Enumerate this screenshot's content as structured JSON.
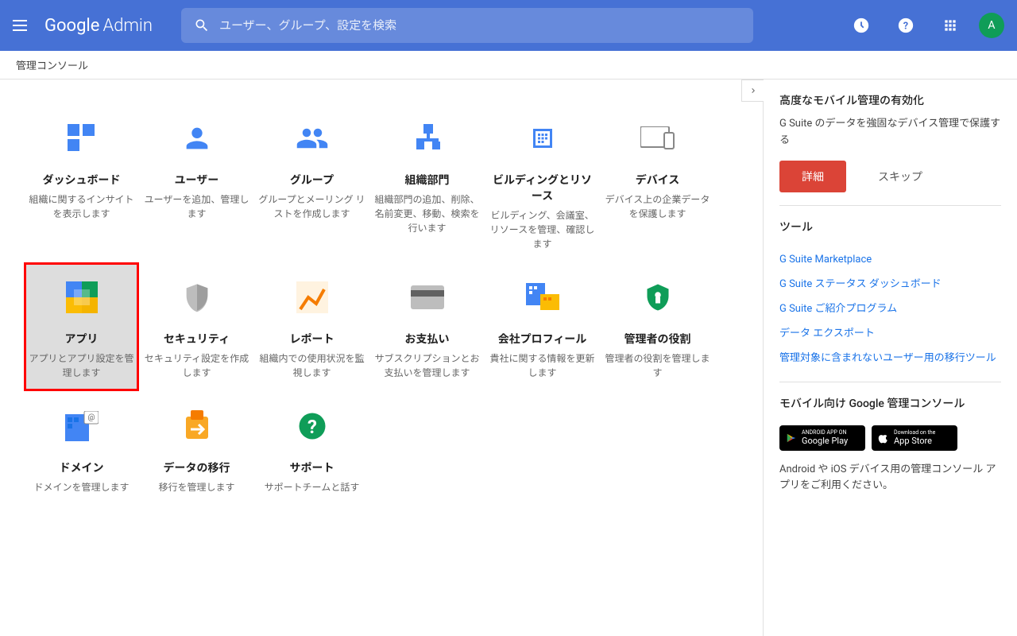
{
  "header": {
    "logo_google": "Google",
    "logo_admin": "Admin",
    "search_placeholder": "ユーザー、グループ、設定を検索",
    "avatar_letter": "A"
  },
  "breadcrumb": "管理コンソール",
  "cards": [
    {
      "title": "ダッシュボード",
      "desc": "組織に関するインサイトを表示します"
    },
    {
      "title": "ユーザー",
      "desc": "ユーザーを追加、管理します"
    },
    {
      "title": "グループ",
      "desc": "グループとメーリング リストを作成します"
    },
    {
      "title": "組織部門",
      "desc": "組織部門の追加、削除、名前変更、移動、検索を行います"
    },
    {
      "title": "ビルディングとリソース",
      "desc": "ビルディング、会議室、リソースを管理、確認します"
    },
    {
      "title": "デバイス",
      "desc": "デバイス上の企業データを保護します"
    },
    {
      "title": "アプリ",
      "desc": "アプリとアプリ設定を管理します"
    },
    {
      "title": "セキュリティ",
      "desc": "セキュリティ設定を作成します"
    },
    {
      "title": "レポート",
      "desc": "組織内での使用状況を監視します"
    },
    {
      "title": "お支払い",
      "desc": "サブスクリプションとお支払いを管理します"
    },
    {
      "title": "会社プロフィール",
      "desc": "貴社に関する情報を更新します"
    },
    {
      "title": "管理者の役割",
      "desc": "管理者の役割を管理します"
    },
    {
      "title": "ドメイン",
      "desc": "ドメインを管理します"
    },
    {
      "title": "データの移行",
      "desc": "移行を管理します"
    },
    {
      "title": "サポート",
      "desc": "サポートチームと話す"
    }
  ],
  "sidebar": {
    "mobile_title": "高度なモバイル管理の有効化",
    "mobile_desc": "G Suite のデータを強固なデバイス管理で保護する",
    "btn_detail": "詳細",
    "btn_skip": "スキップ",
    "tools_title": "ツール",
    "tools": [
      "G Suite Marketplace",
      "G Suite ステータス ダッシュボード",
      "G Suite ご紹介プログラム",
      "データ エクスポート",
      "管理対象に含まれないユーザー用の移行ツール"
    ],
    "mobile_console_title": "モバイル向け Google 管理コンソール",
    "mobile_console_desc": "Android や iOS デバイス用の管理コンソール アプリをご利用ください。",
    "badge_google_top": "ANDROID APP ON",
    "badge_google_main": "Google Play",
    "badge_apple_top": "Download on the",
    "badge_apple_main": "App Store"
  }
}
